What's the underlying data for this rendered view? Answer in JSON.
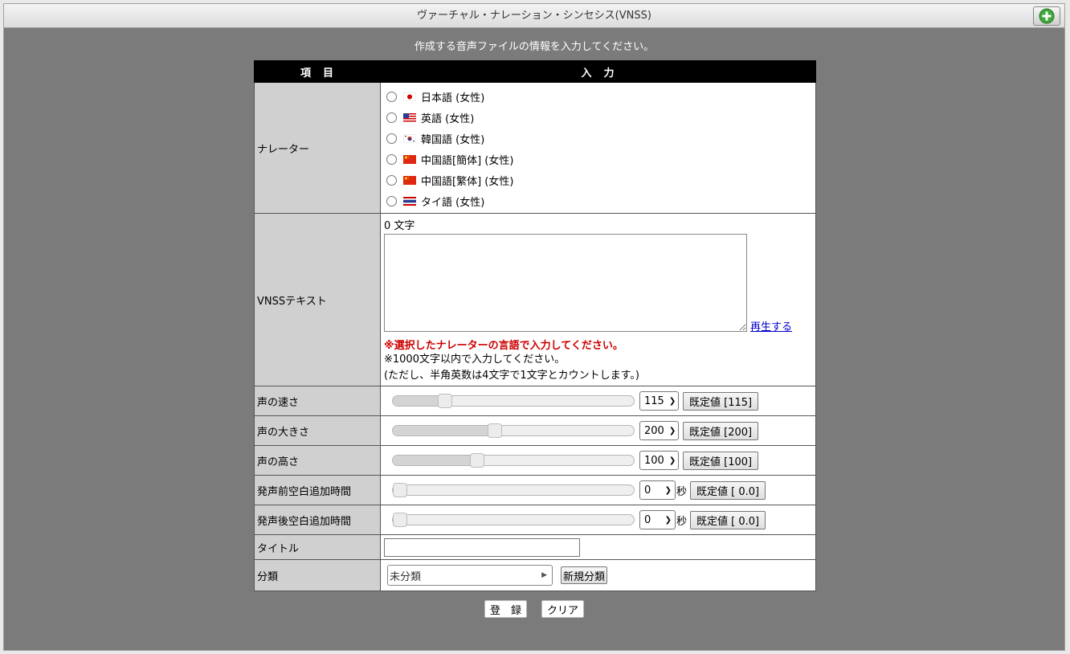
{
  "window": {
    "title": "ヴァーチャル・ナレーション・シンセシス(VNSS)"
  },
  "instruction": "作成する音声ファイルの情報を入力してください。",
  "table": {
    "col_item": "項　目",
    "col_input": "入　力"
  },
  "narrator": {
    "label": "ナレーター",
    "options": [
      {
        "label": "日本語 (女性)",
        "flag": "jp-flag-icon"
      },
      {
        "label": "英語 (女性)",
        "flag": "us-flag-icon"
      },
      {
        "label": "韓国語 (女性)",
        "flag": "kr-flag-icon"
      },
      {
        "label": "中国語[簡体] (女性)",
        "flag": "cn-flag-icon"
      },
      {
        "label": "中国語[繁体] (女性)",
        "flag": "cn-flag-icon"
      },
      {
        "label": "タイ語 (女性)",
        "flag": "th-flag-icon"
      }
    ]
  },
  "text": {
    "label": "VNSSテキスト",
    "count": "0 文字",
    "value": "",
    "play_link": "再生する",
    "warning": "※選択したナレーターの言語で入力してください。",
    "note1": "※1000文字以内で入力してください。",
    "note2": "(ただし、半角英数は4文字で1文字とカウントします。)"
  },
  "speed": {
    "label": "声の速さ",
    "value": "115",
    "default_btn": "既定値 [115]",
    "level": 0.2
  },
  "volume": {
    "label": "声の大きさ",
    "value": "200",
    "default_btn": "既定値 [200]",
    "level": 0.42
  },
  "pitch": {
    "label": "声の高さ",
    "value": "100",
    "default_btn": "既定値 [100]",
    "level": 0.34
  },
  "pre_silence": {
    "label": "発声前空白追加時間",
    "value": "0",
    "unit": "秒",
    "default_btn": "既定値 [ 0.0]",
    "level": 0
  },
  "post_silence": {
    "label": "発声後空白追加時間",
    "value": "0",
    "unit": "秒",
    "default_btn": "既定値 [ 0.0]",
    "level": 0
  },
  "title": {
    "label": "タイトル",
    "value": ""
  },
  "category": {
    "label": "分類",
    "value": "未分類",
    "new_btn": "新規分類"
  },
  "actions": {
    "register": "登　録",
    "clear": "クリア"
  },
  "colors": {
    "background": "#7b7b7b",
    "header": "#000000",
    "label_cell": "#d0d0d0",
    "warning": "#cc0000",
    "link": "#0000cc"
  }
}
